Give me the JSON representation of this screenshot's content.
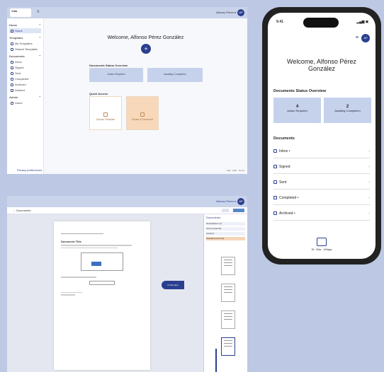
{
  "desktop": {
    "logo": "Villa",
    "user": "Alfonso Pérez ▾",
    "avatar": "AP",
    "sidebar": [
      {
        "section": "Home",
        "items": [
          {
            "label": "Home",
            "active": true
          }
        ]
      },
      {
        "section": "Templates",
        "items": [
          {
            "label": "My Templates"
          },
          {
            "label": "Shared Templates"
          }
        ]
      },
      {
        "section": "Documents",
        "items": [
          {
            "label": "Inbox"
          },
          {
            "label": "Signed"
          },
          {
            "label": "Sent"
          },
          {
            "label": "Completed"
          },
          {
            "label": "Archived"
          },
          {
            "label": "Deleted"
          }
        ]
      },
      {
        "section": "Admin",
        "items": [
          {
            "label": "Users"
          }
        ]
      }
    ],
    "welcome": "Welcome, Alfonso Pérez González",
    "plus": "+",
    "doc_status_title": "Documents Status Overview",
    "cards": [
      "Action Required",
      "Awaiting Completion"
    ],
    "quick_access_title": "Quick Access",
    "quick": [
      "Upload Template",
      "Create a Document"
    ],
    "footer": "Privacy preferences",
    "footer_right": "Villa · Help · Terms"
  },
  "viewer": {
    "user": "Alfonso Pérez ▾",
    "avatar": "AP",
    "back": "← Documento",
    "tab_label": "Firmar aquí",
    "right_title": "Documento",
    "right_rows": [
      "Destinatarios (1)",
      "Firma requerida",
      "Campos",
      "Pendiente de firma"
    ],
    "page_label": "Document Title"
  },
  "mobile": {
    "time": "9:41",
    "signal": "▂▄▆ ◼",
    "avatar": "AP",
    "welcome": "Welcome, Alfonso Pérez González",
    "status_title": "Documents Status Overview",
    "cards": [
      {
        "count": "4",
        "label": "Action Required"
      },
      {
        "count": "2",
        "label": "Awaiting Completion"
      }
    ],
    "documents_title": "Documents",
    "rows": [
      "Inbox •",
      "Signed",
      "Sent",
      "Completed •",
      "Archived •"
    ],
    "brand": "St. Villa · Villaga"
  }
}
